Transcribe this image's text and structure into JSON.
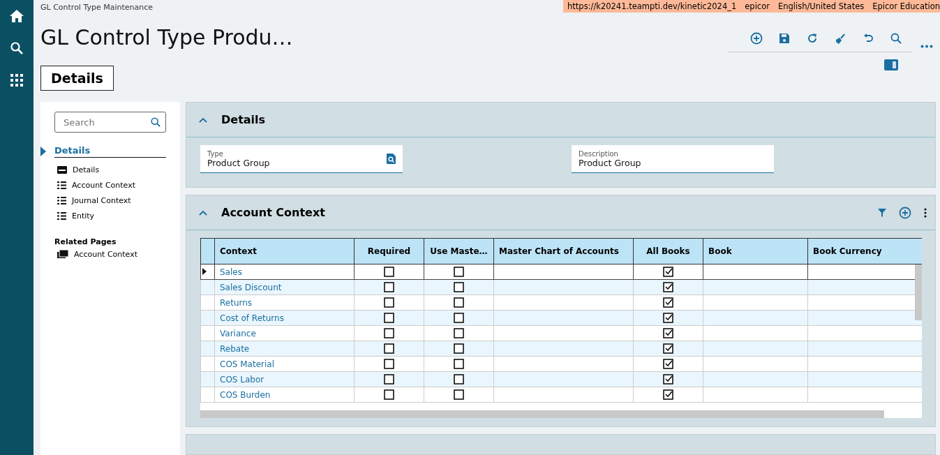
{
  "breadcrumb": "GL Control Type Maintenance",
  "environment": [
    "https://k20241.teampti.dev/kinetic2024_1",
    "epicor",
    "English/United States",
    "Epicor Education"
  ],
  "title": "GL Control Type Produ…",
  "page_tab": "Details",
  "nav": {
    "search_placeholder": "Search",
    "section": "Details",
    "items": [
      {
        "label": "Details",
        "kind": "card"
      },
      {
        "label": "Account Context",
        "kind": "list"
      },
      {
        "label": "Journal Context",
        "kind": "list"
      },
      {
        "label": "Entity",
        "kind": "list"
      }
    ],
    "related_title": "Related Pages",
    "related": [
      {
        "label": "Account Context"
      }
    ]
  },
  "details": {
    "title": "Details",
    "expanded": true,
    "fields": [
      {
        "label": "Type",
        "value": "Product Group",
        "kind": "lookup"
      },
      {
        "label": "Description",
        "value": "Product Group",
        "kind": "text"
      }
    ]
  },
  "account_context": {
    "title": "Account Context",
    "expanded": true,
    "columns": [
      "Context",
      "Required",
      "Use Maste…",
      "Master Chart of Accounts",
      "All Books",
      "Book",
      "Book Currency"
    ],
    "rows": [
      {
        "context": "Sales",
        "required": false,
        "use_master": false,
        "all_books": true,
        "selected": true
      },
      {
        "context": "Sales Discount",
        "required": false,
        "use_master": false,
        "all_books": true,
        "selected": false
      },
      {
        "context": "Returns",
        "required": false,
        "use_master": false,
        "all_books": true,
        "selected": false
      },
      {
        "context": "Cost of Returns",
        "required": false,
        "use_master": false,
        "all_books": true,
        "selected": false
      },
      {
        "context": "Variance",
        "required": false,
        "use_master": false,
        "all_books": true,
        "selected": false
      },
      {
        "context": "Rebate",
        "required": false,
        "use_master": false,
        "all_books": true,
        "selected": false
      },
      {
        "context": "COS Material",
        "required": false,
        "use_master": false,
        "all_books": true,
        "selected": false
      },
      {
        "context": "COS Labor",
        "required": false,
        "use_master": false,
        "all_books": true,
        "selected": false
      },
      {
        "context": "COS Burden",
        "required": false,
        "use_master": false,
        "all_books": true,
        "selected": false
      }
    ]
  }
}
